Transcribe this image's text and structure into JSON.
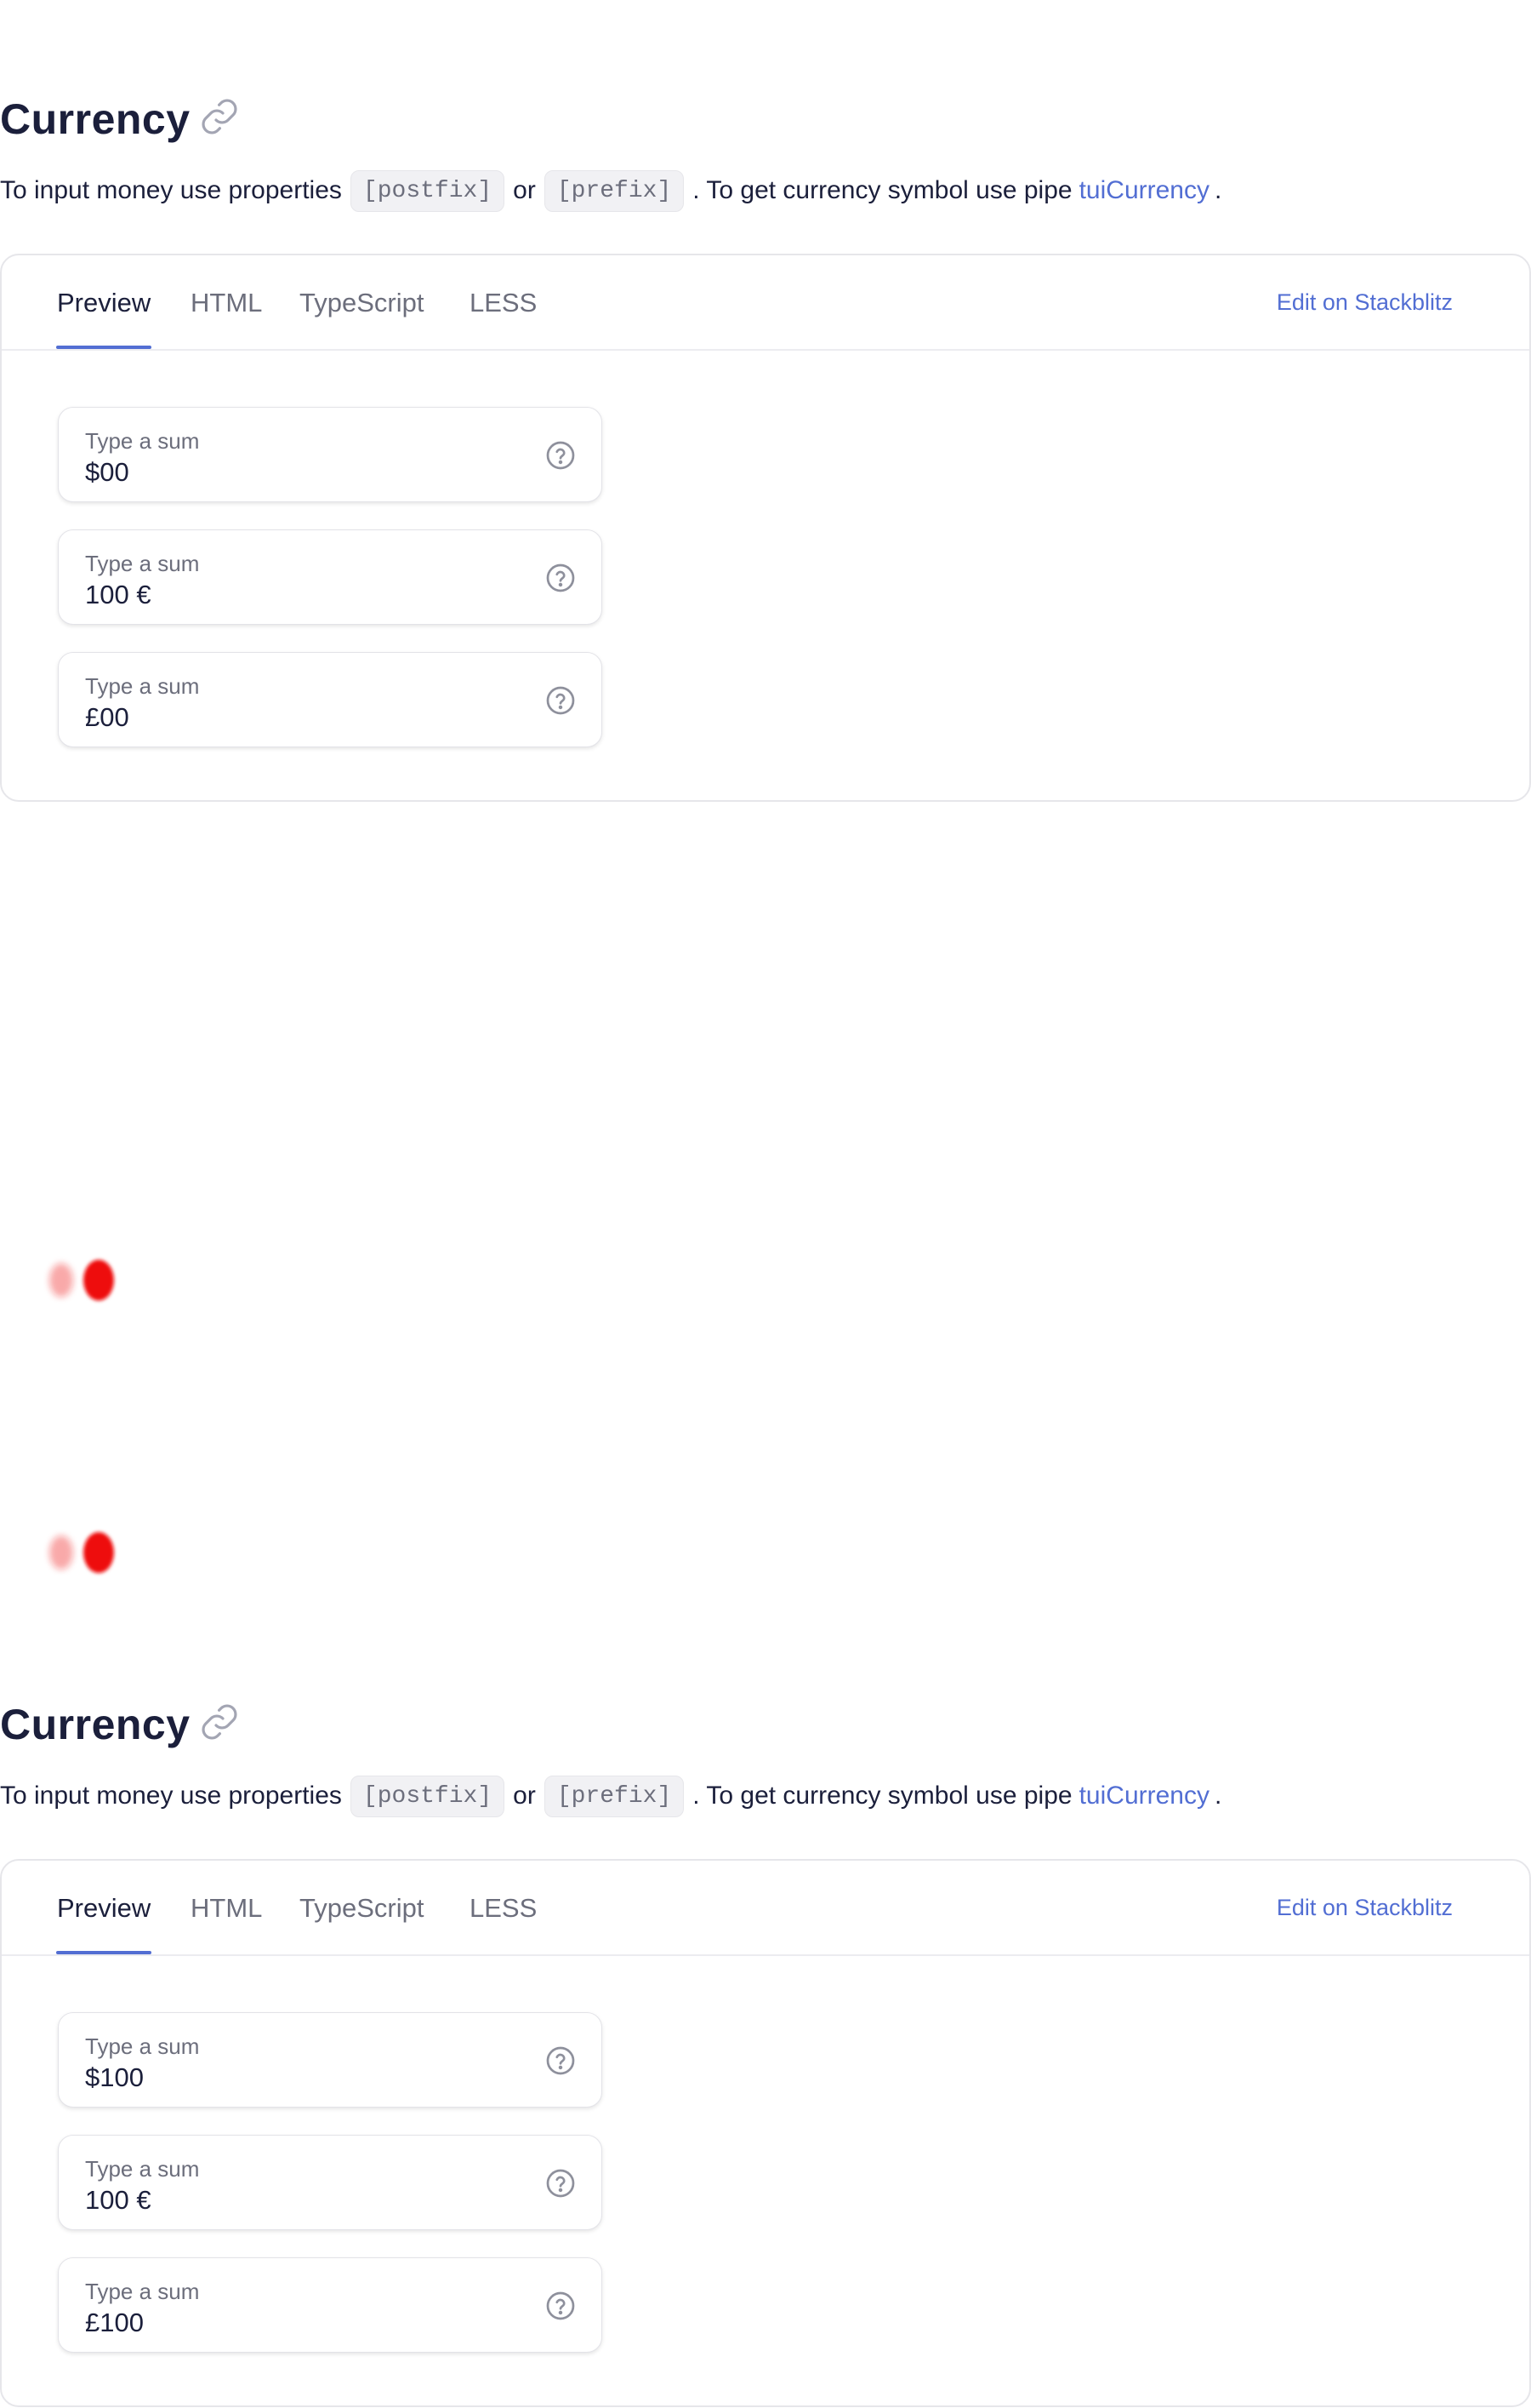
{
  "section_title": "Currency",
  "description": {
    "text_before": "To input money use properties",
    "code_postfix": "[postfix]",
    "text_or": "or",
    "code_prefix": "[prefix]",
    "text_middle": ". To get currency symbol use pipe",
    "pipe_link": "tuiCurrency",
    "text_end": "."
  },
  "tabs": [
    "Preview",
    "HTML",
    "TypeScript",
    "LESS"
  ],
  "active_tab": "Preview",
  "stackblitz_link": "Edit on Stackblitz",
  "sections": [
    {
      "inputs": [
        {
          "label": "Type a sum",
          "value": "$00"
        },
        {
          "label": "Type a sum",
          "value": "100 €"
        },
        {
          "label": "Type a sum",
          "value": "£00"
        }
      ]
    },
    {
      "inputs": [
        {
          "label": "Type a sum",
          "value": "$100"
        },
        {
          "label": "Type a sum",
          "value": "100 €"
        },
        {
          "label": "Type a sum",
          "value": "£100"
        }
      ]
    }
  ],
  "icons": {
    "heading_link": "link-icon",
    "field_help": "question-circle-icon"
  },
  "colors": {
    "accent": "#526ed3",
    "text_primary": "#1b1f3b",
    "text_secondary": "#6c6e7c",
    "blob_red": "#ee1111"
  }
}
